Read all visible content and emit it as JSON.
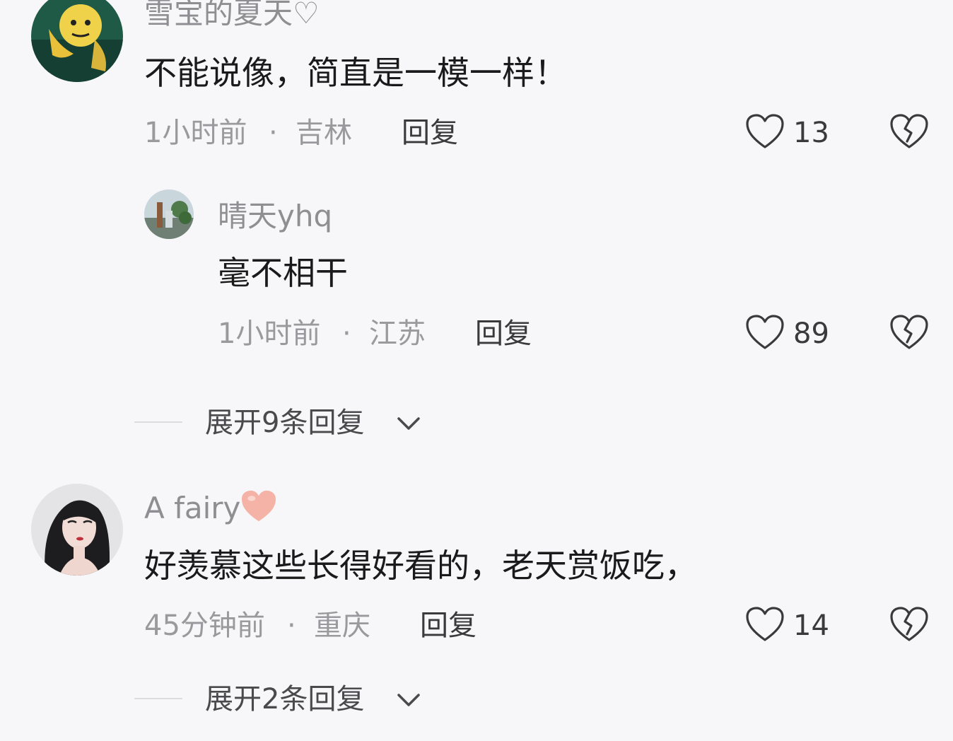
{
  "comments": [
    {
      "username": "雪宝的夏天♡",
      "text": "不能说像，简直是一模一样！",
      "time": "1小时前",
      "location": "吉林",
      "reply_label": "回复",
      "likes": "13"
    },
    {
      "username": "晴天yhq",
      "text": "毫不相干",
      "time": "1小时前",
      "location": "江苏",
      "reply_label": "回复",
      "likes": "89"
    },
    {
      "username": "A fairy",
      "text": "好羡慕这些长得好看的，老天赏饭吃，",
      "time": "45分钟前",
      "location": "重庆",
      "reply_label": "回复",
      "likes": "14"
    }
  ],
  "expand_links": [
    "展开9条回复",
    "展开2条回复"
  ],
  "separator": "·",
  "icons": {
    "like": "heart-outline-icon",
    "dislike": "broken-heart-icon",
    "expand": "chevron-down-icon",
    "emoji": "pink-heart-emoji"
  },
  "colors": {
    "background": "#f7f7f9",
    "username": "#8e8e93",
    "text": "#1a1a1a",
    "meta": "#9a9a9e",
    "emoji_heart": "#f4b3a6"
  }
}
